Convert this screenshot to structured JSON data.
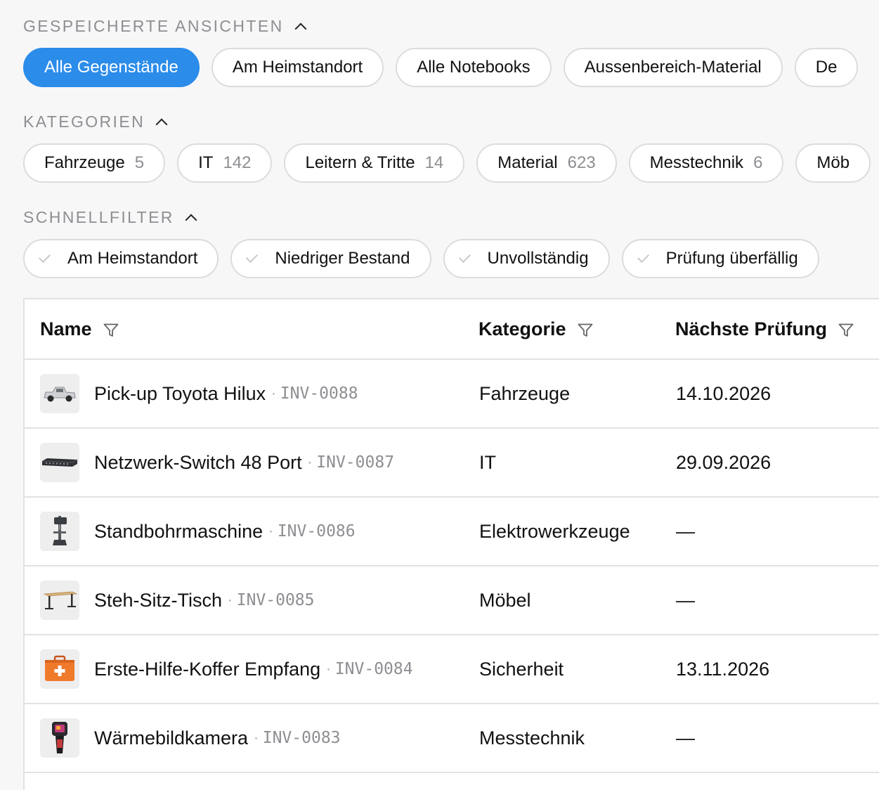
{
  "saved_views": {
    "title": "GESPEICHERTE ANSICHTEN",
    "items": [
      {
        "label": "Alle Gegenstände",
        "active": true
      },
      {
        "label": "Am Heimstandort"
      },
      {
        "label": "Alle Notebooks"
      },
      {
        "label": "Aussenbereich-Material"
      },
      {
        "label": "De"
      }
    ]
  },
  "categories": {
    "title": "KATEGORIEN",
    "items": [
      {
        "label": "Fahrzeuge",
        "count": "5"
      },
      {
        "label": "IT",
        "count": "142"
      },
      {
        "label": "Leitern & Tritte",
        "count": "14"
      },
      {
        "label": "Material",
        "count": "623"
      },
      {
        "label": "Messtechnik",
        "count": "6"
      },
      {
        "label": "Möb",
        "count": ""
      }
    ]
  },
  "quick_filters": {
    "title": "SCHNELLFILTER",
    "items": [
      {
        "label": "Am Heimstandort"
      },
      {
        "label": "Niedriger Bestand"
      },
      {
        "label": "Unvollständig"
      },
      {
        "label": "Prüfung überfällig"
      }
    ]
  },
  "table": {
    "columns": {
      "name": "Name",
      "category": "Kategorie",
      "next_inspection": "Nächste Prüfung"
    },
    "rows": [
      {
        "name": "Pick-up Toyota Hilux",
        "sep": "·",
        "code": "INV-0088",
        "category": "Fahrzeuge",
        "next_inspection": "14.10.2026",
        "thumb": "pickup-truck-icon"
      },
      {
        "name": "Netzwerk-Switch 48 Port",
        "sep": "·",
        "code": "INV-0087",
        "category": "IT",
        "next_inspection": "29.09.2026",
        "thumb": "network-switch-icon"
      },
      {
        "name": "Standbohrmaschine",
        "sep": "·",
        "code": "INV-0086",
        "category": "Elektrowerkzeuge",
        "next_inspection": "—",
        "thumb": "drill-press-icon"
      },
      {
        "name": "Steh-Sitz-Tisch",
        "sep": "·",
        "code": "INV-0085",
        "category": "Möbel",
        "next_inspection": "—",
        "thumb": "desk-icon"
      },
      {
        "name": "Erste-Hilfe-Koffer Empfang",
        "sep": "·",
        "code": "INV-0084",
        "category": "Sicherheit",
        "next_inspection": "13.11.2026",
        "thumb": "first-aid-kit-icon"
      },
      {
        "name": "Wärmebildkamera",
        "sep": "·",
        "code": "INV-0083",
        "category": "Messtechnik",
        "next_inspection": "—",
        "thumb": "thermal-camera-icon"
      }
    ]
  },
  "colors": {
    "accent": "#2b8cea",
    "muted_text": "#8e8e93",
    "border": "#dcdce0",
    "background": "#f7f7f8"
  }
}
